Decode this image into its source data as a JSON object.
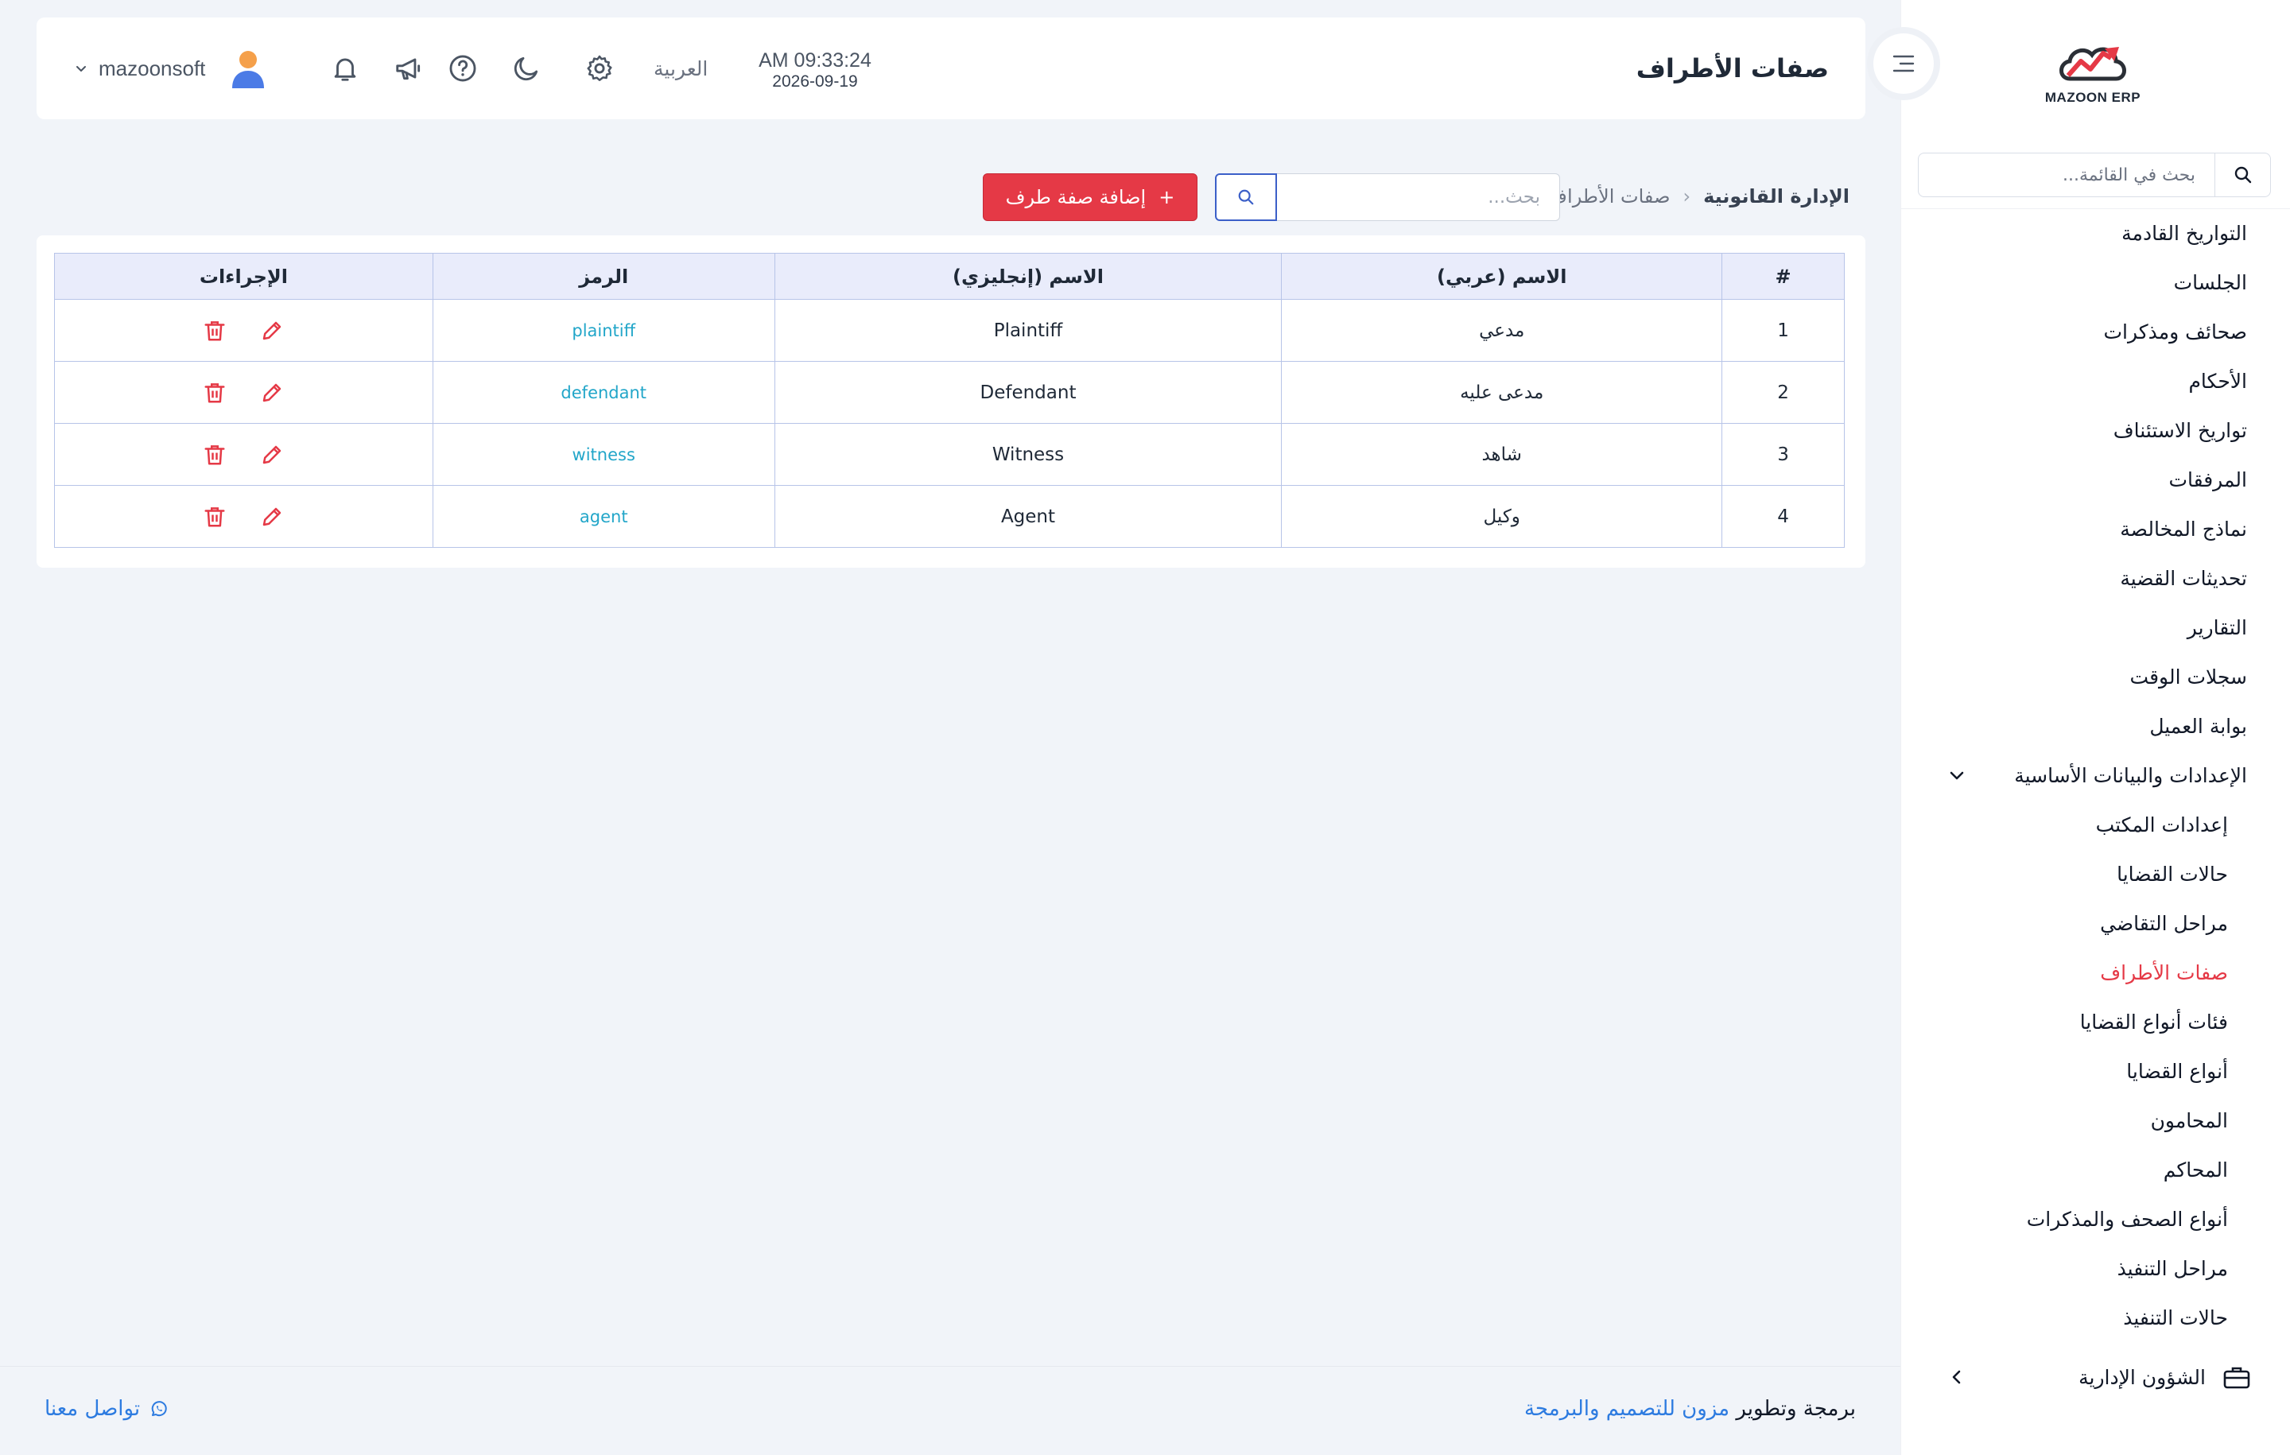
{
  "brand": {
    "name": "MAZOON ERP",
    "accent": "#e53946"
  },
  "sidebar": {
    "search_placeholder": "بحث في القائمة...",
    "items": [
      {
        "label": "التواريخ القادمة"
      },
      {
        "label": "الجلسات"
      },
      {
        "label": "صحائف ومذكرات"
      },
      {
        "label": "الأحكام"
      },
      {
        "label": "تواريخ الاستئناف"
      },
      {
        "label": "المرفقات"
      },
      {
        "label": "نماذج المخالصة"
      },
      {
        "label": "تحديثات القضية"
      },
      {
        "label": "التقارير"
      },
      {
        "label": "سجلات الوقت"
      },
      {
        "label": "بوابة العميل"
      }
    ],
    "settings_group": {
      "label": "الإعدادات والبيانات الأساسية",
      "children": [
        {
          "label": "إعدادات المكتب"
        },
        {
          "label": "حالات القضايا"
        },
        {
          "label": "مراحل التقاضي"
        },
        {
          "label": "صفات الأطراف",
          "active": true
        },
        {
          "label": "فئات أنواع القضايا"
        },
        {
          "label": "أنواع القضايا"
        },
        {
          "label": "المحامون"
        },
        {
          "label": "المحاكم"
        },
        {
          "label": "أنواع الصحف والمذكرات"
        },
        {
          "label": "مراحل التنفيذ"
        },
        {
          "label": "حالات التنفيذ"
        }
      ]
    },
    "admin_group": {
      "label": "الشؤون الإدارية"
    }
  },
  "header": {
    "title": "صفات الأطراف",
    "time": "AM 09:33:24",
    "date": "2026-09-19",
    "language": "العربية",
    "username": "mazoonsoft"
  },
  "breadcrumb": {
    "root": "الإدارة القانونية",
    "separator": "‹",
    "current": "صفات الأطراف"
  },
  "toolbar": {
    "search_placeholder": "بحث...",
    "add_label": "إضافة صفة طرف",
    "add_icon": "+"
  },
  "table": {
    "headers": [
      "#",
      "الاسم (عربي)",
      "الاسم (إنجليزي)",
      "الرمز",
      "الإجراءات"
    ],
    "rows": [
      {
        "num": "1",
        "name_ar": "مدعي",
        "name_en": "Plaintiff",
        "code": "plaintiff"
      },
      {
        "num": "2",
        "name_ar": "مدعى عليه",
        "name_en": "Defendant",
        "code": "defendant"
      },
      {
        "num": "3",
        "name_ar": "شاهد",
        "name_en": "Witness",
        "code": "witness"
      },
      {
        "num": "4",
        "name_ar": "وكيل",
        "name_en": "Agent",
        "code": "agent"
      }
    ]
  },
  "footer": {
    "credit_prefix": "برمجة وتطوير",
    "credit_company": "مزون للتصميم والبرمجة",
    "contact": "تواصل معنا"
  },
  "colors": {
    "accent_red": "#e53946",
    "link_blue": "#2d7be0",
    "code_cyan": "#22a6c9",
    "table_header_bg": "#e9ecfb"
  }
}
